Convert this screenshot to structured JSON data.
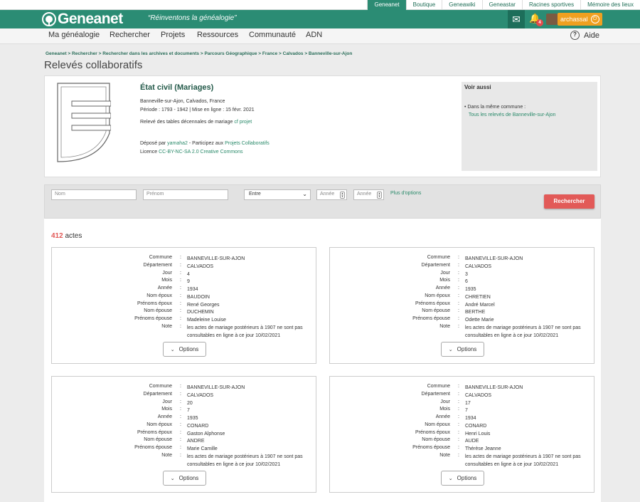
{
  "top_tabs": [
    "Geneanet",
    "Boutique",
    "Geneawiki",
    "Geneastar",
    "Racines sportives",
    "Mémoire des lieux"
  ],
  "header": {
    "logo": "Geneanet",
    "slogan": "“Réinventons la généalogie”",
    "notif_count": "4",
    "username": "archassal"
  },
  "nav": [
    "Ma généalogie",
    "Rechercher",
    "Projets",
    "Ressources",
    "Communauté",
    "ADN"
  ],
  "help": "Aide",
  "breadcrumb": "Geneanet > Rechercher > Rechercher dans les archives et documents > Parcours Géographique > France > Calvados > Banneville-sur-Ajon",
  "page_title": "Relevés collaboratifs",
  "record": {
    "title": "État civil (Mariages)",
    "location": "Banneville-sur-Ajon, Calvados, France",
    "period_label": "Période : ",
    "period": "1793 - 1942",
    "online_label": " | Mise en ligne : ",
    "online": "15 févr. 2021",
    "desc": "Relevé des tables décennales de mariage ",
    "desc_link": "cf projet",
    "deposit_label": "Déposé par ",
    "depositor": "yamaha2",
    "participate_label": " - Participez aux ",
    "participate_link": "Projets Collaboratifs",
    "licence_label": "Licence ",
    "licence_link": "CC-BY-NC-SA 2.0 Creative Commons"
  },
  "voir_aussi": {
    "title": "Voir aussi",
    "item_label": "Dans la même commune :",
    "item_link": "Tous les relevés de Banneville-sur-Ajon"
  },
  "search": {
    "nom_placeholder": "Nom",
    "prenom_placeholder": "Prénom",
    "range_select": "Entre",
    "annee1_placeholder": "Année",
    "annee2_placeholder": "Année",
    "more_options": "Plus d'options",
    "button": "Rechercher"
  },
  "results_count": "412",
  "results_unit": " actes",
  "field_labels": [
    "Commune",
    "Département",
    "Jour",
    "Mois",
    "Année",
    "Nom époux",
    "Prénoms époux",
    "Nom épouse",
    "Prénoms épouse",
    "Note"
  ],
  "cards": [
    {
      "values": [
        "BANNEVILLE-SUR-AJON",
        "CALVADOS",
        "4",
        "9",
        "1934",
        "BAUDOIN",
        "René Georges",
        "DUCHEMIN",
        "Madeleine Louise",
        "les actes de mariage postérieurs à 1907 ne sont pas consultables en ligne à ce jour 10/02/2021"
      ]
    },
    {
      "values": [
        "BANNEVILLE-SUR-AJON",
        "CALVADOS",
        "3",
        "6",
        "1935",
        "CHRETIEN",
        "André Marcel",
        "BERTHE",
        "Odette Marie",
        "les actes de mariage postérieurs à 1907 ne sont pas consultables en ligne à ce jour 10/02/2021"
      ]
    },
    {
      "values": [
        "BANNEVILLE-SUR-AJON",
        "CALVADOS",
        "20",
        "7",
        "1935",
        "CONARD",
        "Gaston Alphonse",
        "ANDRE",
        "Marie Camille",
        "les actes de mariage postérieurs à 1907 ne sont pas consultables en ligne à ce jour 10/02/2021"
      ]
    },
    {
      "values": [
        "BANNEVILLE-SUR-AJON",
        "CALVADOS",
        "17",
        "7",
        "1934",
        "CONARD",
        "Henri Louis",
        "AUDE",
        "Thérèse Jeanne",
        "les actes de mariage postérieurs à 1907 ne sont pas consultables en ligne à ce jour 10/02/2021"
      ]
    }
  ],
  "options_label": "Options"
}
